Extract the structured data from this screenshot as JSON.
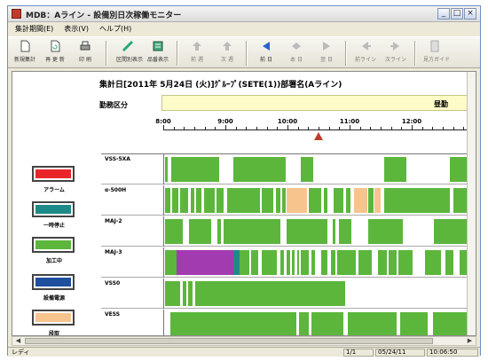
{
  "window": {
    "title": "MDB：Aライン - 設備別日次稼働モニター",
    "controls": {
      "minimize": "_",
      "restore": "□",
      "close": "×"
    }
  },
  "menu": [
    "集計期間(E)",
    "表示(V)",
    "ヘルプ(H)"
  ],
  "toolbar": [
    {
      "label": "新規集計",
      "icon": "new-doc-icon",
      "enabled": true
    },
    {
      "label": "再 更 新",
      "icon": "refresh-doc-icon",
      "enabled": true
    },
    {
      "label": "印 刷",
      "icon": "print-icon",
      "enabled": true
    },
    {
      "label": "区間別表示",
      "icon": "zone-view-icon",
      "enabled": true
    },
    {
      "label": "品番表示",
      "icon": "part-number-icon",
      "enabled": true
    },
    {
      "label": "前 週",
      "icon": "prev-week-icon",
      "enabled": false
    },
    {
      "label": "次 週",
      "icon": "next-week-icon",
      "enabled": false
    },
    {
      "label": "前 日",
      "icon": "prev-day-icon",
      "enabled": true
    },
    {
      "label": "本 日",
      "icon": "today-icon",
      "enabled": false
    },
    {
      "label": "翌 日",
      "icon": "next-day-icon",
      "enabled": false
    },
    {
      "label": "前ライン",
      "icon": "prev-line-icon",
      "enabled": false
    },
    {
      "label": "次ライン",
      "icon": "next-line-icon",
      "enabled": false
    },
    {
      "label": "見方ガイド",
      "icon": "guide-icon",
      "enabled": false
    }
  ],
  "chart_data": {
    "type": "gantt",
    "title": "集計日[2011年 5月24日 (火)]ｸﾞﾙｰﾌﾟ(SETE(1))部署名(Aライン)",
    "shift_label": "勤務区分",
    "shift_value": "昼勤",
    "time_axis": {
      "start": 8.0,
      "end": 13.0,
      "ticks": [
        "8:00",
        "9:00",
        "10:00",
        "11:00",
        "12:00"
      ]
    },
    "current_time": 10.5,
    "legend": [
      {
        "key": "alarm",
        "label": "アラーム",
        "color": "#e8262a"
      },
      {
        "key": "pause",
        "label": "一時停止",
        "color": "#1e8a87"
      },
      {
        "key": "running",
        "label": "加工中",
        "color": "#5cb63c"
      },
      {
        "key": "power",
        "label": "設備電源",
        "color": "#1f4f9f"
      },
      {
        "key": "setup",
        "label": "段取",
        "color": "#f7c48d"
      }
    ],
    "state_colors": {
      "running": "#5cb63c",
      "setup": "#f7c48d",
      "alarm": "#e8262a",
      "pause": "#1e8a87",
      "power": "#1f4f9f",
      "other": "#a23bb0"
    },
    "rows": [
      {
        "name": "VSS-5XA",
        "segments": [
          [
            "running",
            8.02,
            8.05
          ],
          [
            "running",
            8.12,
            8.88
          ],
          [
            "running",
            9.1,
            9.93
          ],
          [
            "running",
            10.18,
            10.37
          ],
          [
            "running",
            11.5,
            11.85
          ],
          [
            "running",
            12.55,
            13.0
          ]
        ]
      },
      {
        "name": "α-500H",
        "segments": [
          [
            "running",
            8.02,
            8.1
          ],
          [
            "running",
            8.13,
            8.22
          ],
          [
            "running",
            8.26,
            8.38
          ],
          [
            "running",
            8.42,
            8.48
          ],
          [
            "running",
            8.51,
            8.6
          ],
          [
            "running",
            8.64,
            8.8
          ],
          [
            "running",
            8.84,
            8.95
          ],
          [
            "running",
            9.0,
            9.52
          ],
          [
            "running",
            9.56,
            9.74
          ],
          [
            "running",
            9.78,
            9.85
          ],
          [
            "running",
            9.88,
            9.93
          ],
          [
            "setup",
            9.95,
            10.28
          ],
          [
            "running",
            10.3,
            10.5
          ],
          [
            "running",
            10.54,
            10.6
          ],
          [
            "running",
            10.7,
            10.85
          ],
          [
            "running",
            10.9,
            10.97
          ],
          [
            "setup",
            11.02,
            11.23
          ],
          [
            "running",
            11.25,
            11.33
          ],
          [
            "setup",
            11.35,
            11.45
          ],
          [
            "running",
            11.5,
            12.55
          ],
          [
            "running",
            12.6,
            13.0
          ]
        ]
      },
      {
        "name": "MAJ-2",
        "segments": [
          [
            "running",
            8.02,
            8.3
          ],
          [
            "running",
            8.4,
            8.75
          ],
          [
            "running",
            8.85,
            8.9
          ],
          [
            "running",
            8.95,
            9.85
          ],
          [
            "running",
            9.95,
            10.6
          ],
          [
            "running",
            10.68,
            10.72
          ],
          [
            "running",
            10.78,
            10.98
          ],
          [
            "running",
            11.25,
            11.8
          ],
          [
            "running",
            12.3,
            13.0
          ]
        ]
      },
      {
        "name": "MAJ-3",
        "segments": [
          [
            "running",
            8.02,
            8.2
          ],
          [
            "other",
            8.2,
            9.1
          ],
          [
            "pause",
            9.1,
            9.2
          ],
          [
            "running",
            9.2,
            9.35
          ],
          [
            "running",
            9.38,
            9.5
          ],
          [
            "running",
            9.55,
            9.8
          ],
          [
            "running",
            9.85,
            9.9
          ],
          [
            "running",
            9.95,
            10.0
          ],
          [
            "running",
            10.04,
            10.08
          ],
          [
            "running",
            10.12,
            10.14
          ],
          [
            "running",
            10.18,
            10.3
          ],
          [
            "running",
            10.34,
            10.4
          ],
          [
            "running",
            10.5,
            10.6
          ],
          [
            "running",
            10.66,
            10.72
          ],
          [
            "running",
            10.76,
            11.05
          ],
          [
            "running",
            11.1,
            11.3
          ],
          [
            "running",
            11.4,
            11.55
          ],
          [
            "running",
            11.58,
            11.7
          ],
          [
            "running",
            11.73,
            11.95
          ],
          [
            "running",
            12.15,
            12.4
          ],
          [
            "running",
            12.48,
            12.6
          ],
          [
            "running",
            12.7,
            13.0
          ]
        ]
      },
      {
        "name": "VSS0",
        "segments": [
          [
            "running",
            8.02,
            8.25
          ],
          [
            "running",
            8.3,
            8.35
          ],
          [
            "running",
            8.38,
            8.45
          ],
          [
            "running",
            8.5,
            10.88
          ]
        ]
      },
      {
        "name": "VESS",
        "segments": [
          [
            "running",
            8.1,
            10.1
          ],
          [
            "running",
            10.14,
            10.3
          ],
          [
            "running",
            10.34,
            10.85
          ],
          [
            "running",
            10.92,
            11.7
          ],
          [
            "running",
            11.76,
            12.2
          ],
          [
            "running",
            12.28,
            13.0
          ]
        ]
      }
    ]
  },
  "status": {
    "ready": "レディ",
    "page": "1/1",
    "date": "05/24/11",
    "time": "10:06:50"
  }
}
